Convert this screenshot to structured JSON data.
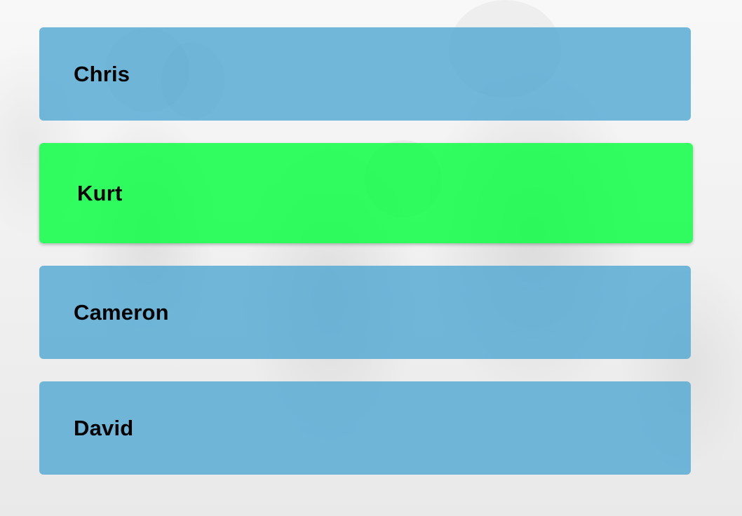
{
  "options": [
    {
      "label": "Chris",
      "selected": false
    },
    {
      "label": "Kurt",
      "selected": true
    },
    {
      "label": "Cameron",
      "selected": false
    },
    {
      "label": "David",
      "selected": false
    }
  ],
  "colors": {
    "option_default": "#4ba5d2",
    "option_selected": "#00ff3c",
    "text": "#000000"
  }
}
